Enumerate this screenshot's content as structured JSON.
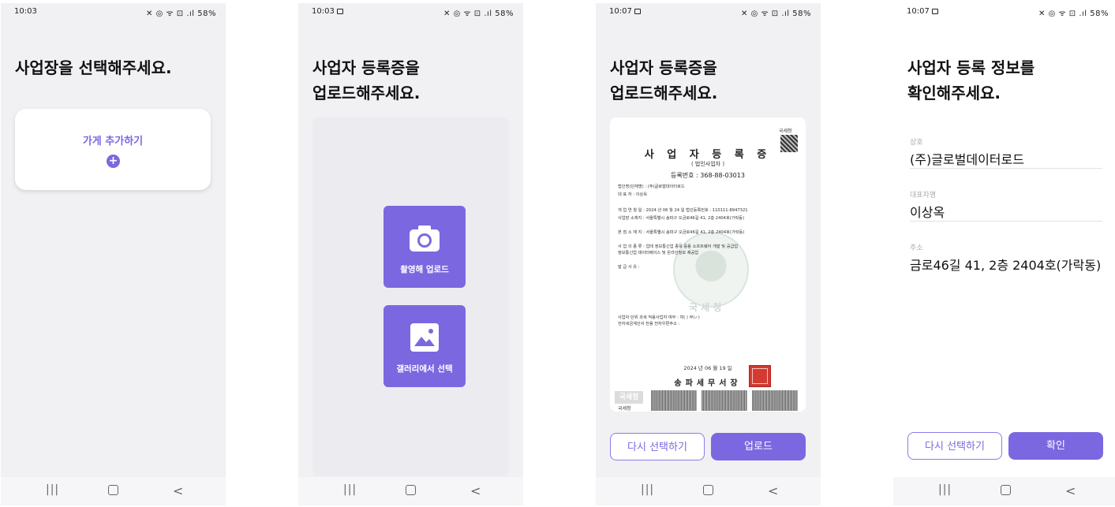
{
  "screens": [
    {
      "status": {
        "time": "10:03",
        "right": "✕ ◎ ᯤ ⊡ .ıl 58%"
      },
      "title_lines": [
        "사업장을 선택해주세요."
      ],
      "store_card": {
        "label": "가게 추가하기",
        "plus": "+"
      },
      "navbar": {
        "recent": "|||",
        "back": "<"
      }
    },
    {
      "status": {
        "time": "10:03",
        "right": "✕ ◎ ᯤ ⊡ .ıl 58%"
      },
      "title_lines": [
        "사업자 등록증을",
        "업로드해주세요."
      ],
      "camera_button": "촬영해 업로드",
      "gallery_button": "갤러리에서 선택",
      "navbar": {
        "recent": "|||",
        "back": "<"
      }
    },
    {
      "status": {
        "time": "10:07",
        "right": "✕ ◎ ᯤ ⊡ .ıl 58%"
      },
      "title_lines": [
        "사업자 등록증을",
        "업로드해주세요."
      ],
      "certificate": {
        "seal_logo": "국세청",
        "title": "사 업 자 등 록 증",
        "subtitle": "( 법인사업자 )",
        "reg_no": "등록번호 : 368-88-03013",
        "lines": [
          "법인명(단체명) : (주)글로벌데이터로드",
          "대    표    자 : 이상옥",
          "개 업 연 월 일 : 2024 년 06 월 24 일      법인등록번호 : 110111-8947321",
          "사업장 소재지 : 서울특별시 송파구 오금로46길 41, 2층 2404호(가락동)",
          "본 점 소 재 지 : 서울특별시 송파구 오금로46길 41, 2층 2404호(가락동)",
          "사 업 의 종 류 : 업태 정보통신업          종목 응용 소프트웨어 개발 및 공급업",
          "                     정보통신업                  데이터베이스 및 온라인정보 제공업",
          "발 급 사 유 :",
          "사업자 단위 과세 적용사업자 여부 : 여( ) 부(✓)",
          "전자세금계산서 전용 전자우편주소 :"
        ],
        "emblem_label": "국 세 청",
        "date": "2024 년 06 월 19 일",
        "office": "송파세무서장",
        "footer_logo": "국세청",
        "footer_text": "국세청"
      },
      "reselect_button": "다시 선택하기",
      "upload_button": "업로드",
      "navbar": {
        "recent": "|||",
        "back": "<"
      }
    },
    {
      "status": {
        "time": "10:07",
        "right": "✕ ◎ ᯤ ⊡ .ıl 58%"
      },
      "title_lines": [
        "사업자 등록 정보를",
        "확인해주세요."
      ],
      "fields": [
        {
          "label": "상호",
          "value": "(주)글로벌데이터로드"
        },
        {
          "label": "대표자명",
          "value": "이상옥"
        },
        {
          "label": "주소",
          "value": "금로46길 41, 2층 2404호(가락동)"
        }
      ],
      "reselect_button": "다시 선택하기",
      "confirm_button": "확인",
      "navbar": {
        "recent": "|||",
        "back": "<"
      }
    }
  ],
  "colors": {
    "accent": "#7b68e0",
    "background": "#f1f1f4"
  }
}
